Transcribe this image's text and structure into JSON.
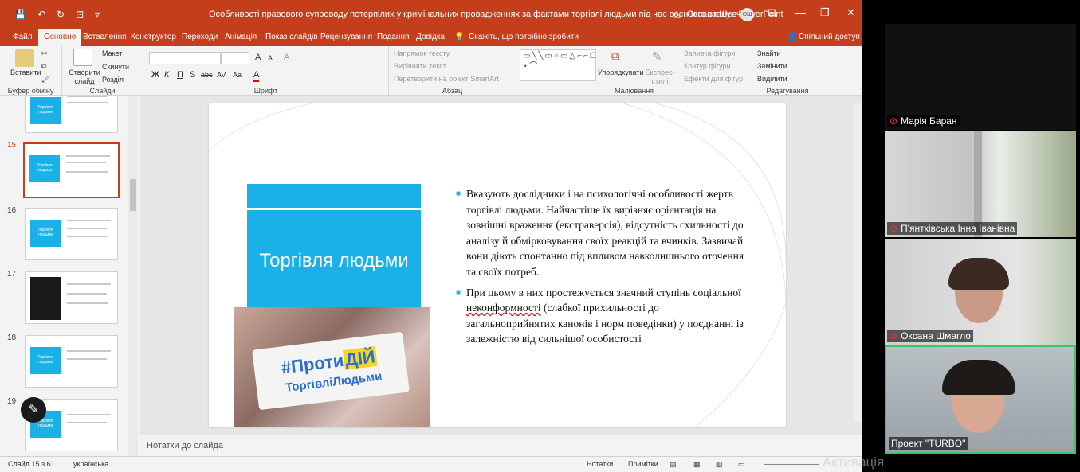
{
  "window": {
    "title": "Особливості правового супроводу потерпілих у кримінальних провадженнях за фактами торгівлі людьми під час воєнного стану - PowerPoint",
    "user": "Оксана Шевчук",
    "user_initials": "ОШ",
    "minimize": "—",
    "restore": "❐",
    "close": "✕",
    "ribbon_options": "⊞",
    "warning": "⚠"
  },
  "quick_access": {
    "save": "💾",
    "undo": "↶",
    "redo": "↻",
    "present": "⊡",
    "more": "▿"
  },
  "tabs": [
    {
      "label": "Файл"
    },
    {
      "label": "Основне"
    },
    {
      "label": "Вставлення"
    },
    {
      "label": "Конструктор"
    },
    {
      "label": "Переходи"
    },
    {
      "label": "Анімація"
    },
    {
      "label": "Показ слайдів"
    },
    {
      "label": "Рецензування"
    },
    {
      "label": "Подання"
    },
    {
      "label": "Довідка"
    }
  ],
  "tell_me": "Скажіть, що потрібно зробити",
  "share": "Спільний доступ",
  "ribbon": {
    "clipboard": {
      "paste": "Вставити",
      "label": "Буфер обміну"
    },
    "slides": {
      "new": "Створити слайд",
      "layout": "Макет",
      "reset": "Скинути",
      "section": "Розділ",
      "label": "Слайди"
    },
    "font": {
      "bold": "Ж",
      "italic": "К",
      "underline": "П",
      "shadow": "S",
      "strike": "abc",
      "spacing": "AV",
      "case": "Aa",
      "grow": "A",
      "shrink": "A",
      "clear": "A",
      "color": "A",
      "label": "Шрифт"
    },
    "paragraph": {
      "direction": "Напрямок тексту",
      "align": "Вирівняти текст",
      "smartart": "Перетворити на об'єкт SmartArt",
      "label": "Абзац"
    },
    "drawing": {
      "shapes": "▭╲╲▭○▭△⌐⌐☐◇⇨⇩{}⋆⌒",
      "arrange": "Упорядкувати",
      "styles": "Експрес-стилі",
      "fill": "Заливка фігури",
      "outline": "Контур фігури",
      "effects": "Ефекти для фігур",
      "label": "Малювання"
    },
    "editing": {
      "find": "Знайти",
      "replace": "Замінити",
      "select": "Виділити",
      "label": "Редагування"
    }
  },
  "thumbnails": [
    {
      "num": "",
      "title": "Торгівля людьми"
    },
    {
      "num": "15",
      "title": "Торгівля людьми",
      "selected": true
    },
    {
      "num": "16",
      "title": "Торгівля людьми"
    },
    {
      "num": "17",
      "title": ""
    },
    {
      "num": "18",
      "title": "Торгівля людьми"
    },
    {
      "num": "19",
      "title": "Торгівля людьми"
    }
  ],
  "slide": {
    "title": "Торгівля людьми",
    "placard_line1": "#Проти",
    "placard_line1_hl": "ДІЙ",
    "placard_line2": "ТоргівліЛюдьми",
    "bullet1": "Вказують дослідники і на психологічні особливості жертв торгівлі людьми. Найчастіше їх вирізняє орієнтація на зовнішні враження (екстраверсія), відсутність схильності до аналізу й обмірковування своїх реакцій та вчинків. Зазвичай вони діють спонтанно під впливом навколишнього оточення та своїх потреб.",
    "bullet2_pre": "При цьому в них простежується значний ступінь соціальної ",
    "bullet2_err": "неконформності",
    "bullet2_post": " (слабкої прихильності до загальноприйнятих канонів і норм поведінки) у поєднанні із залежністю від сильнішої особистості"
  },
  "notes_placeholder": "Нотатки до слайда",
  "status": {
    "slide_count": "Слайд 15 з 61",
    "language": "українська",
    "notes": "Нотатки",
    "comments": "Примітки"
  },
  "watermark": "Активація Windows",
  "participants": [
    {
      "name": "Марія Баран"
    },
    {
      "name": "П'янтківська Інна Іванівна"
    },
    {
      "name": "Оксана Шмагло"
    },
    {
      "name": "Проект \"TURBO\""
    }
  ],
  "colors": {
    "accent": "#c43e1c",
    "slide_blue": "#1ab0e8",
    "speaker_border": "#3cc46a"
  }
}
